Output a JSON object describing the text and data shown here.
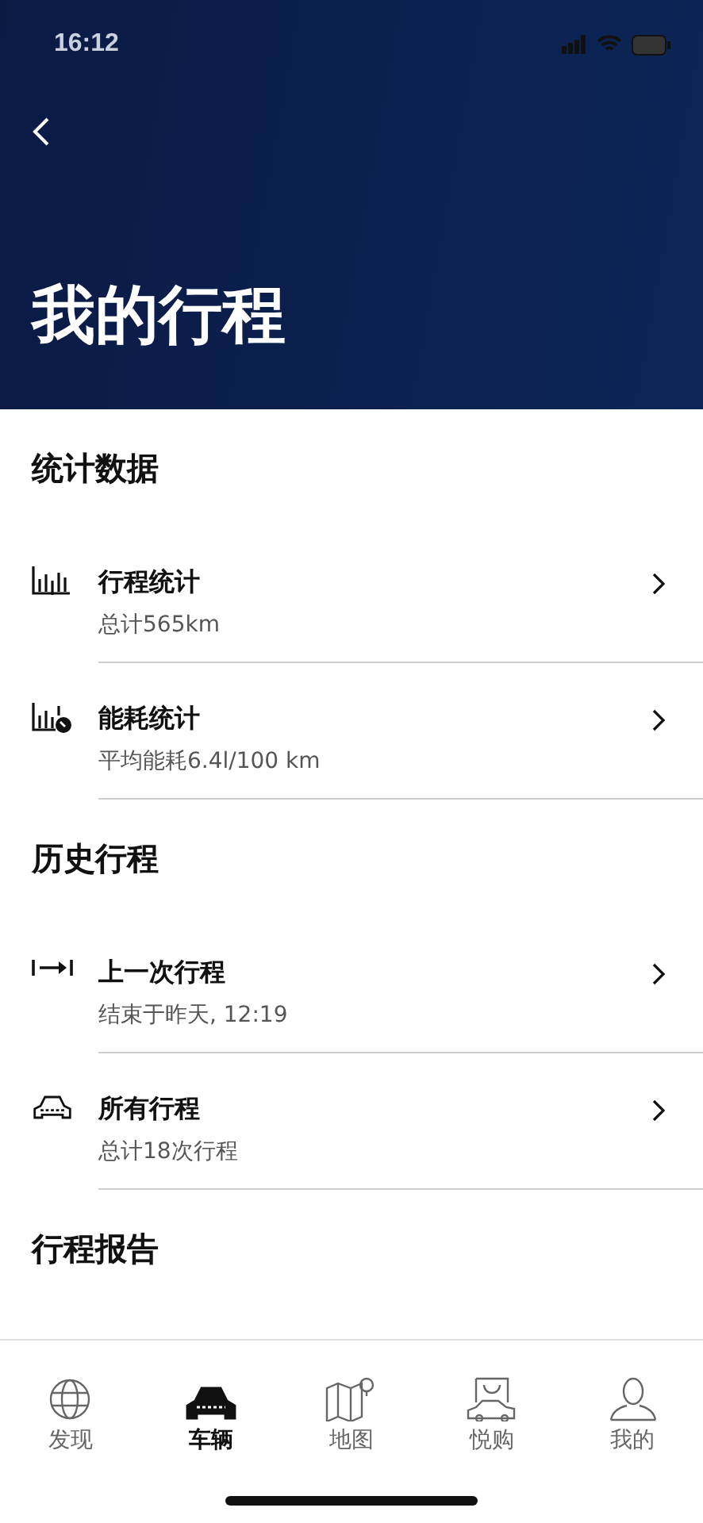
{
  "status_bar": {
    "time": "16:12"
  },
  "header": {
    "title": "我的行程"
  },
  "sections": [
    {
      "title": "统计数据",
      "items": [
        {
          "kind": "bars",
          "title": "行程统计",
          "subtitle": "总计565km"
        },
        {
          "kind": "bars-gauge",
          "title": "能耗统计",
          "subtitle": "平均能耗6.4l/100 km"
        }
      ]
    },
    {
      "title": "历史行程",
      "items": [
        {
          "kind": "arrow",
          "title": "上一次行程",
          "subtitle": "结束于昨天, 12:19"
        },
        {
          "kind": "car",
          "title": "所有行程",
          "subtitle": "总计18次行程"
        }
      ]
    },
    {
      "title": "行程报告"
    }
  ],
  "tabs": [
    {
      "kind": "globe",
      "label": "发现",
      "selected": false
    },
    {
      "kind": "car",
      "label": "车辆",
      "selected": true
    },
    {
      "kind": "map",
      "label": "地图",
      "selected": false
    },
    {
      "kind": "shop",
      "label": "悦购",
      "selected": false
    },
    {
      "kind": "person",
      "label": "我的",
      "selected": false
    }
  ]
}
